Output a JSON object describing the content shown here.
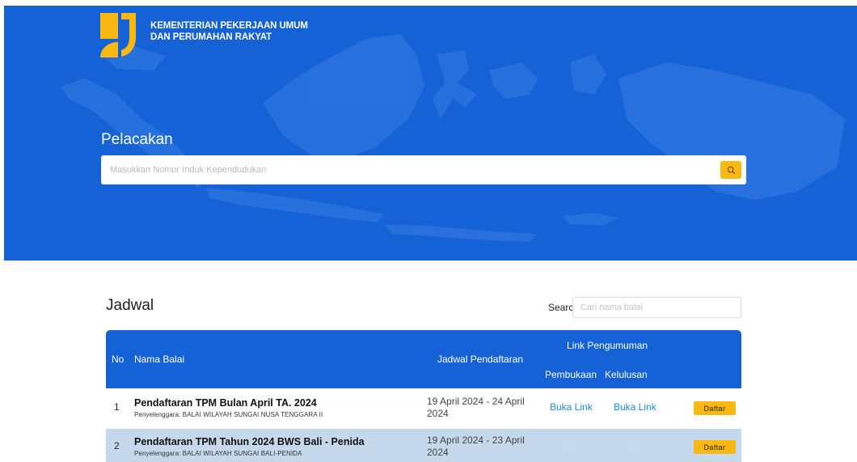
{
  "header": {
    "ministry_line1": "KEMENTERIAN PEKERJAAN UMUM",
    "ministry_line2": "DAN PERUMAHAN RAKYAT",
    "brand_colors": {
      "primary_blue": "#1562d6",
      "accent_yellow": "#f9b812"
    },
    "logo_icon": "pupr-logo-icon"
  },
  "tracking": {
    "title": "Pelacakan",
    "placeholder": "Masukkan Nomor Induk Kependudukan",
    "value": "",
    "button_icon": "search-icon"
  },
  "schedule": {
    "title": "Jadwal",
    "search_label": "Search:",
    "search_placeholder": "Cari nama balai",
    "columns": {
      "no": "No",
      "name": "Nama Balai",
      "date": "Jadwal Pendaftaran",
      "link_group": "Link Pengumuman",
      "opening": "Pembukaan",
      "passing": "Kelulusan"
    },
    "rows": [
      {
        "no": "1",
        "title": "Pendaftaran TPM Bulan April TA. 2024",
        "organizer": "Penyelenggara: BALAI WILAYAH SUNGAI NUSA TENGGARA II",
        "date": "19 April 2024 - 24 April 2024",
        "opening": "Buka Link",
        "passing": "Buka Link",
        "action": "Daftar"
      },
      {
        "no": "2",
        "title": "Pendaftaran TPM Tahun 2024 BWS Bali - Penida",
        "organizer": "Penyelenggara: BALAI WILAYAH SUNGAI BALI-PENIDA",
        "date": "19 April 2024 - 23 April 2024",
        "opening": "-",
        "passing": "-",
        "action": "Daftar"
      }
    ]
  }
}
